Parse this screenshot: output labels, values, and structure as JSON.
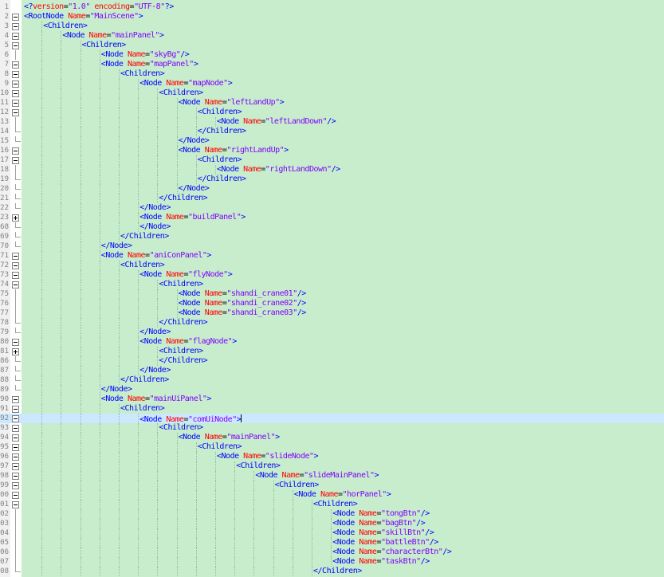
{
  "editor": {
    "lines": [
      {
        "no": "1",
        "indent": 0,
        "fold": "none",
        "text": "<?version=\"1.0\" encoding=\"UTF-8\"?>",
        "kind": "decl"
      },
      {
        "no": "2",
        "indent": 0,
        "fold": "minus",
        "tag": "RootNode",
        "attr": "Name",
        "value": "MainScene",
        "close": ">"
      },
      {
        "no": "3",
        "indent": 1,
        "fold": "minus",
        "tag": "Children",
        "close": ">"
      },
      {
        "no": "4",
        "indent": 2,
        "fold": "minus",
        "tag": "Node",
        "attr": "Name",
        "value": "mainPanel",
        "close": ">"
      },
      {
        "no": "5",
        "indent": 3,
        "fold": "minus",
        "tag": "Children",
        "close": ">"
      },
      {
        "no": "6",
        "indent": 4,
        "fold": "line",
        "tag": "Node",
        "attr": "Name",
        "value": "skyBg",
        "close": "/>"
      },
      {
        "no": "7",
        "indent": 4,
        "fold": "minus",
        "tag": "Node",
        "attr": "Name",
        "value": "mapPanel",
        "close": ">"
      },
      {
        "no": "8",
        "indent": 5,
        "fold": "minus",
        "tag": "Children",
        "close": ">"
      },
      {
        "no": "9",
        "indent": 6,
        "fold": "minus",
        "tag": "Node",
        "attr": "Name",
        "value": "mapNode",
        "close": ">"
      },
      {
        "no": "10",
        "indent": 7,
        "fold": "minus",
        "tag": "Children",
        "close": ">"
      },
      {
        "no": "11",
        "indent": 8,
        "fold": "minus",
        "tag": "Node",
        "attr": "Name",
        "value": "leftLandUp",
        "close": ">"
      },
      {
        "no": "12",
        "indent": 9,
        "fold": "minus",
        "tag": "Children",
        "close": ">"
      },
      {
        "no": "13",
        "indent": 10,
        "fold": "line",
        "tag": "Node",
        "attr": "Name",
        "value": "leftLandDown",
        "close": "/>"
      },
      {
        "no": "14",
        "indent": 9,
        "fold": "end",
        "endtag": "Children"
      },
      {
        "no": "15",
        "indent": 8,
        "fold": "end",
        "endtag": "Node"
      },
      {
        "no": "16",
        "indent": 8,
        "fold": "minus",
        "tag": "Node",
        "attr": "Name",
        "value": "rightLandUp",
        "close": ">"
      },
      {
        "no": "17",
        "indent": 9,
        "fold": "minus",
        "tag": "Children",
        "close": ">"
      },
      {
        "no": "18",
        "indent": 10,
        "fold": "line",
        "tag": "Node",
        "attr": "Name",
        "value": "rightLandDown",
        "close": "/>"
      },
      {
        "no": "19",
        "indent": 9,
        "fold": "end",
        "endtag": "Children"
      },
      {
        "no": "20",
        "indent": 8,
        "fold": "end",
        "endtag": "Node"
      },
      {
        "no": "21",
        "indent": 7,
        "fold": "end",
        "endtag": "Children"
      },
      {
        "no": "22",
        "indent": 6,
        "fold": "end",
        "endtag": "Node"
      },
      {
        "no": "23",
        "indent": 6,
        "fold": "plus",
        "tag": "Node",
        "attr": "Name",
        "value": "buildPanel",
        "close": ">"
      },
      {
        "no": "68",
        "indent": 6,
        "fold": "end",
        "endtag": "Node"
      },
      {
        "no": "69",
        "indent": 5,
        "fold": "end",
        "endtag": "Children"
      },
      {
        "no": "70",
        "indent": 4,
        "fold": "end",
        "endtag": "Node"
      },
      {
        "no": "71",
        "indent": 4,
        "fold": "minus",
        "tag": "Node",
        "attr": "Name",
        "value": "aniConPanel",
        "close": ">"
      },
      {
        "no": "72",
        "indent": 5,
        "fold": "minus",
        "tag": "Children",
        "close": ">"
      },
      {
        "no": "73",
        "indent": 6,
        "fold": "minus",
        "tag": "Node",
        "attr": "Name",
        "value": "flyNode",
        "close": ">"
      },
      {
        "no": "74",
        "indent": 7,
        "fold": "minus",
        "tag": "Children",
        "close": ">"
      },
      {
        "no": "75",
        "indent": 8,
        "fold": "line",
        "tag": "Node",
        "attr": "Name",
        "value": "shandi_crane01",
        "close": "/>"
      },
      {
        "no": "76",
        "indent": 8,
        "fold": "line",
        "tag": "Node",
        "attr": "Name",
        "value": "shandi_crane02",
        "close": "/>"
      },
      {
        "no": "77",
        "indent": 8,
        "fold": "line",
        "tag": "Node",
        "attr": "Name",
        "value": "shandi_crane03",
        "close": "/>"
      },
      {
        "no": "78",
        "indent": 7,
        "fold": "end",
        "endtag": "Children"
      },
      {
        "no": "79",
        "indent": 6,
        "fold": "end",
        "endtag": "Node"
      },
      {
        "no": "80",
        "indent": 6,
        "fold": "minus",
        "tag": "Node",
        "attr": "Name",
        "value": "flagNode",
        "close": ">"
      },
      {
        "no": "81",
        "indent": 7,
        "fold": "plus",
        "tag": "Children",
        "close": ">"
      },
      {
        "no": "86",
        "indent": 7,
        "fold": "end",
        "endtag": "Children"
      },
      {
        "no": "87",
        "indent": 6,
        "fold": "end",
        "endtag": "Node"
      },
      {
        "no": "88",
        "indent": 5,
        "fold": "end",
        "endtag": "Children"
      },
      {
        "no": "89",
        "indent": 4,
        "fold": "end",
        "endtag": "Node"
      },
      {
        "no": "90",
        "indent": 4,
        "fold": "minus",
        "tag": "Node",
        "attr": "Name",
        "value": "mainUiPanel",
        "close": ">"
      },
      {
        "no": "91",
        "indent": 5,
        "fold": "minus",
        "tag": "Children",
        "close": ">"
      },
      {
        "no": "92",
        "indent": 6,
        "fold": "minus",
        "tag": "Node",
        "attr": "Name",
        "value": "comUiNode",
        "close": ">",
        "current": true
      },
      {
        "no": "93",
        "indent": 7,
        "fold": "minus",
        "tag": "Children",
        "close": ">"
      },
      {
        "no": "94",
        "indent": 8,
        "fold": "minus",
        "tag": "Node",
        "attr": "Name",
        "value": "mainPanel",
        "close": ">"
      },
      {
        "no": "95",
        "indent": 9,
        "fold": "minus",
        "tag": "Children",
        "close": ">"
      },
      {
        "no": "96",
        "indent": 10,
        "fold": "minus",
        "tag": "Node",
        "attr": "Name",
        "value": "slideNode",
        "close": ">"
      },
      {
        "no": "97",
        "indent": 11,
        "fold": "minus",
        "tag": "Children",
        "close": ">"
      },
      {
        "no": "98",
        "indent": 12,
        "fold": "minus",
        "tag": "Node",
        "attr": "Name",
        "value": "slideMainPanel",
        "close": ">"
      },
      {
        "no": "99",
        "indent": 13,
        "fold": "minus",
        "tag": "Children",
        "close": ">"
      },
      {
        "no": "00",
        "indent": 14,
        "fold": "minus",
        "tag": "Node",
        "attr": "Name",
        "value": "horPanel",
        "close": ">"
      },
      {
        "no": "01",
        "indent": 15,
        "fold": "minus",
        "tag": "Children",
        "close": ">"
      },
      {
        "no": "02",
        "indent": 16,
        "fold": "line",
        "tag": "Node",
        "attr": "Name",
        "value": "tongBtn",
        "close": "/>"
      },
      {
        "no": "03",
        "indent": 16,
        "fold": "line",
        "tag": "Node",
        "attr": "Name",
        "value": "bagBtn",
        "close": "/>"
      },
      {
        "no": "04",
        "indent": 16,
        "fold": "line",
        "tag": "Node",
        "attr": "Name",
        "value": "skillBtn",
        "close": "/>"
      },
      {
        "no": "05",
        "indent": 16,
        "fold": "line",
        "tag": "Node",
        "attr": "Name",
        "value": "battleBtn",
        "close": "/>"
      },
      {
        "no": "06",
        "indent": 16,
        "fold": "line",
        "tag": "Node",
        "attr": "Name",
        "value": "characterBtn",
        "close": "/>"
      },
      {
        "no": "07",
        "indent": 16,
        "fold": "line",
        "tag": "Node",
        "attr": "Name",
        "value": "taskBtn",
        "close": "/>"
      },
      {
        "no": "08",
        "indent": 15,
        "fold": "end",
        "endtag": "Children"
      }
    ]
  },
  "colors": {
    "background": "#c7edcc",
    "current_line": "#cce8ff",
    "tag": "#0000ff",
    "attribute": "#ff0000",
    "string": "#8000ff"
  }
}
